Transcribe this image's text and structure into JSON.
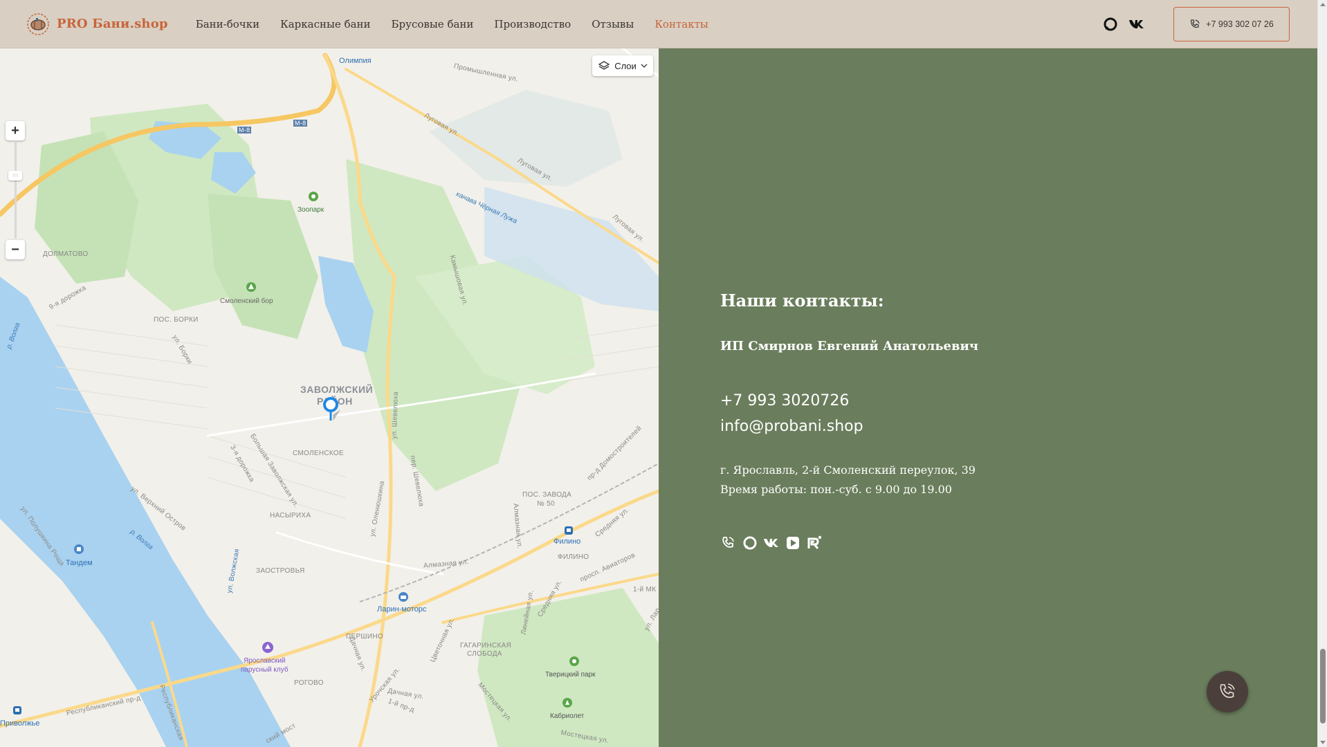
{
  "header": {
    "logo_text": "PRO Бани.shop",
    "nav": [
      {
        "label": "Бани-бочки"
      },
      {
        "label": "Каркасные бани"
      },
      {
        "label": "Брусовые бани"
      },
      {
        "label": "Производство"
      },
      {
        "label": "Отзывы"
      },
      {
        "label": "Контакты",
        "active": true
      }
    ],
    "phone": "+7 993 302 07 26",
    "accent_color": "#c8643a",
    "icons": [
      "whatsapp-icon",
      "vk-icon",
      "phone-icon"
    ]
  },
  "map": {
    "layers_label": "Слои",
    "zoom_in": "+",
    "zoom_out": "−",
    "labels": {
      "olimpia": "Олимпия",
      "promyshl": "Промышленная ул.",
      "m8a": "М-8",
      "m8b": "М-8",
      "lugovaya1": "Луговая ул.",
      "lugovaya2": "Луговая ул.",
      "lugovaya3": "Луговая ул.",
      "kanava": "канава Чёрная Лужа",
      "zoopark": "Зоопарк",
      "kamyshovaya": "Камышовая ул.",
      "dolmatovo": "ДОЛМАТОВО",
      "doroga9": "9-я дорожка",
      "smol_bor": "Смоленский бор",
      "pos_borki": "ПОС. БОРКИ",
      "ul_borki": "ул. Борки",
      "volga1": "р. Волга",
      "zavolzhsky": "ЗАВОЛЖСКИЙ",
      "rayon": "РАЙОН",
      "shevelyukha": "ул. Шевелюха",
      "domostroit": "пр-д Домостроителей",
      "smolenskoe": "СМОЛЕНСКОЕ",
      "bolshaya_zav": "Большая Заволжская ул.",
      "doroga3": "3-я дорожка",
      "per_shev": "пер. Шевелюха",
      "olenyushkina": "ул. Оленюшкина",
      "pos_zavoda": "ПОС. ЗАВОДА",
      "n50": "№ 50",
      "poluchkina": "ул. Полушкина Роща",
      "verkh_ostrov": "ул. Верхний Остров",
      "nasyrikha": "НАСЫРИХА",
      "almaznaya_v": "Алмазная ул.",
      "srednyaya": "Средняя ул.",
      "filino": "Филино",
      "filino2": "ФИЛИНО",
      "volga2": "р. Волга",
      "tandem": "Тандем",
      "volzhskaya": "ул. Волжская",
      "zaostrovya": "ЗАОСТРОВЬЯ",
      "almaznaya": "Алмазная ул.",
      "aviatorov": "просп. Авиаторов",
      "larin": "Ларин-моторс",
      "lineynaya": "Линейная ул.",
      "srednyaya2": "Средняя ул.",
      "mk": "1-й МК",
      "ul_lar": "ул. Лар",
      "pershino": "ПЕРШИНО",
      "dachnaya_v": "Дачная ул.",
      "tsvetochnaya": "Цветочная ул.",
      "gagarinskaya": "ГАГАРИНСКАЯ",
      "sloboda": "СЛОБОДА",
      "yaroslavsky": "Ярославский",
      "parusny": "парусный клуб",
      "tvertsky": "Тверицкий парк",
      "rogovo": "РОГОВО",
      "urochskaya": "Урочская ул.",
      "dachnaya": "Дачная ул.",
      "respub_pr": "Республиканский пр-д",
      "privolzhie": "Приволжье",
      "respublikan": "Республиканская",
      "prd1": "1-й пр-д",
      "mostovskaya": "Мостецкая ул.",
      "kabriolet": "Кабриолет",
      "mostetskaya2": "Мостецкая ул.",
      "most": "ский мост"
    }
  },
  "contacts": {
    "title": "Наши контакты:",
    "company": "ИП Смирнов Евгений Анатольевич",
    "phone": "+7 993 3020726",
    "email": "info@probani.shop",
    "address": "г. Ярославль, 2-й Смоленский переулок, 39",
    "hours": "Время работы: пон.-суб. с 9.00 до 19.00",
    "social_icons": [
      "phone-icon",
      "whatsapp-icon",
      "vk-icon",
      "youtube-icon",
      "rutube-icon"
    ],
    "bg_color": "#6a7d5c"
  }
}
